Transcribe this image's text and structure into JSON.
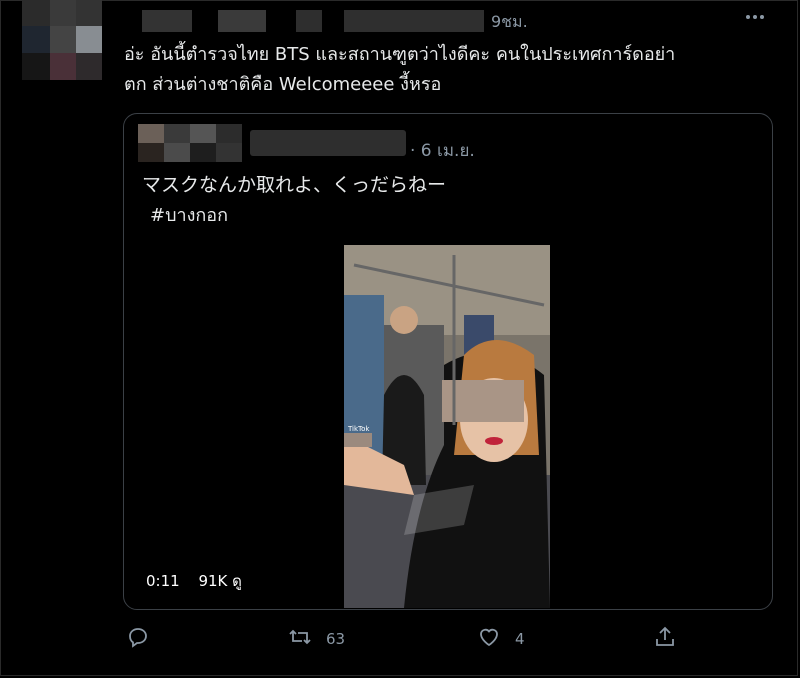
{
  "tweet": {
    "time": "9ชม.",
    "more_icon": "more-horizontal-icon",
    "text_line1": "อ่ะ อันนี้ตำรวจไทย BTS และสถานฑูตว่าไงดีคะ คนในประเทศการ์ดอย่า",
    "text_line2": "ตก ส่วนต่างชาติคือ Welcomeeee งี้หรอ"
  },
  "quote": {
    "date": "· 6 เม.ย.",
    "text": "マスクなんか取れよ、くっだらねー",
    "hashtag": "#บางกอก",
    "video": {
      "duration": "0:11",
      "views": "91K ดู",
      "watermark": "TikTok"
    }
  },
  "actions": {
    "reply": {
      "icon": "reply-icon",
      "count": ""
    },
    "retweet": {
      "icon": "retweet-icon",
      "count": "63"
    },
    "like": {
      "icon": "heart-icon",
      "count": "4"
    },
    "share": {
      "icon": "share-icon",
      "count": ""
    }
  },
  "colors": {
    "background": "#000000",
    "text": "#e7e9ea",
    "secondary": "#8b98a5",
    "border": "#3b4046"
  }
}
